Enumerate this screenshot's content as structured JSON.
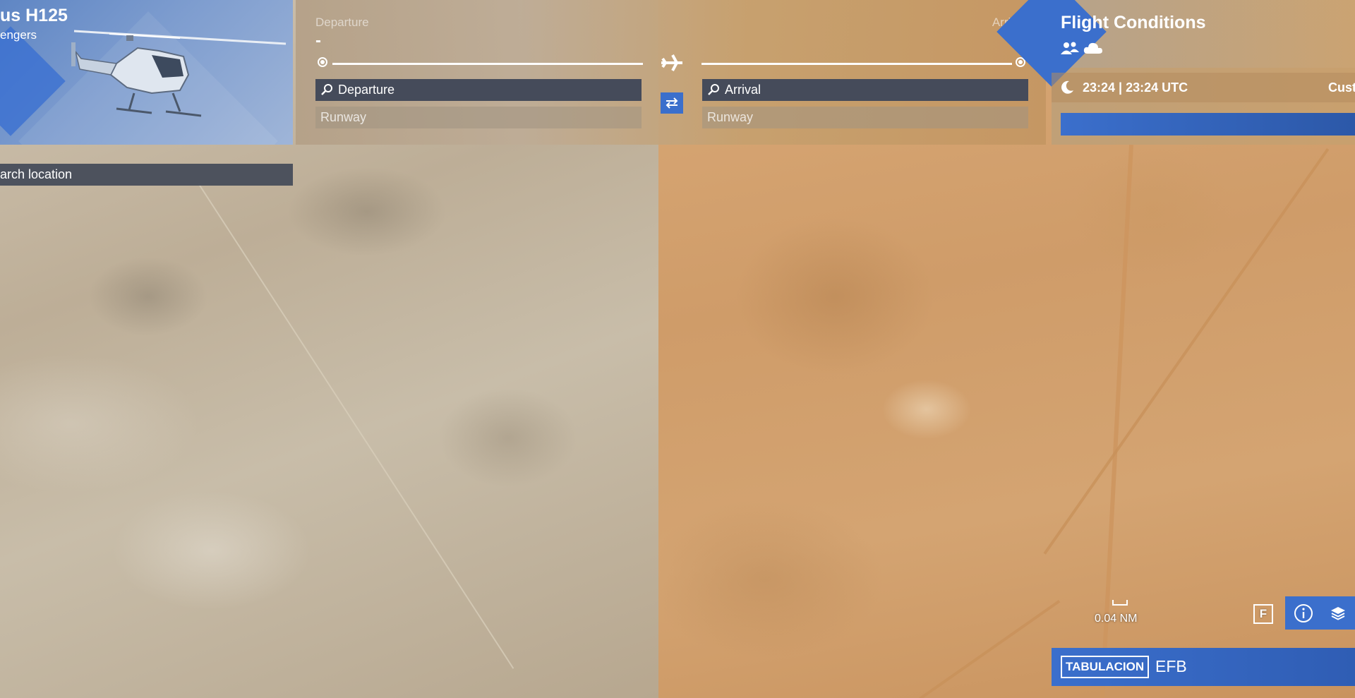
{
  "aircraft": {
    "name": "us H125",
    "subtitle": "engers",
    "image": "helicopter"
  },
  "route": {
    "departure_label": "Departure",
    "arrival_label": "Arrival",
    "departure_code": "-",
    "arrival_code": "-",
    "departure_search_placeholder": "Departure",
    "arrival_search_placeholder": "Arrival",
    "departure_runway_placeholder": "Runway",
    "arrival_runway_placeholder": "Runway"
  },
  "conditions": {
    "title": "Flight Conditions",
    "time": "23:24 |  23:24 UTC",
    "preset": "Cust"
  },
  "map": {
    "search_placeholder": "arch location",
    "scale_label": "0.04 NM",
    "f_key": "F"
  },
  "efb": {
    "key": "TABULACION",
    "label": "EFB"
  },
  "colors": {
    "accent": "#3b6fcc",
    "field_bg": "#454b5a"
  }
}
